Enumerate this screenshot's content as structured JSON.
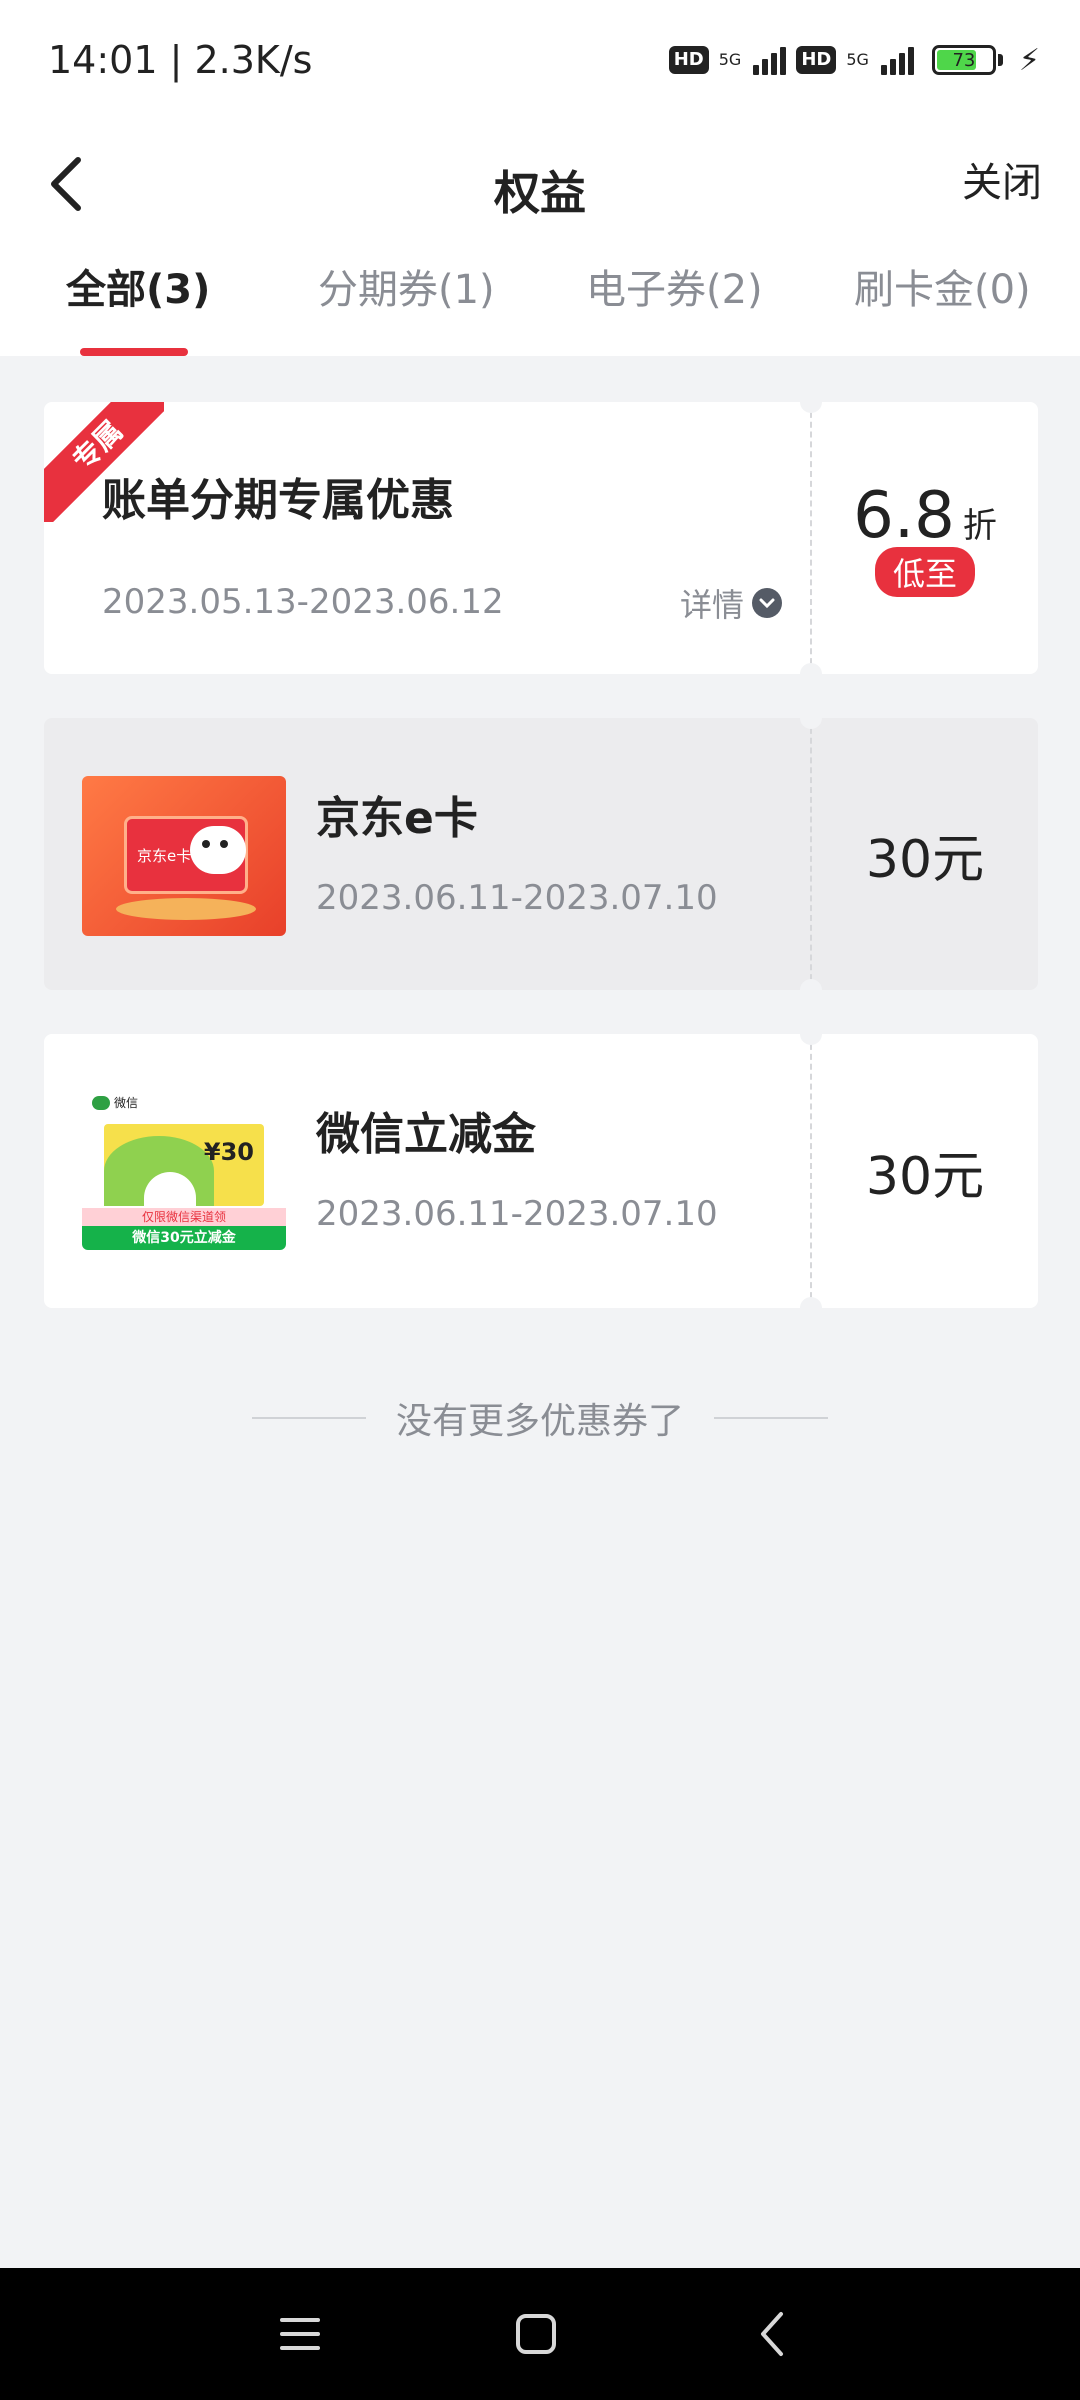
{
  "status": {
    "time_speed": "14:01 | 2.3K/s",
    "hd": "HD",
    "net": "5G",
    "battery": "73"
  },
  "nav": {
    "title": "权益",
    "close": "关闭"
  },
  "tabs": [
    {
      "label": "全部(3)"
    },
    {
      "label": "分期券(1)"
    },
    {
      "label": "电子券(2)"
    },
    {
      "label": "刷卡金(0)"
    }
  ],
  "coupons": [
    {
      "badge": "专属",
      "title": "账单分期专属优惠",
      "date": "2023.05.13-2023.06.12",
      "detail": "详情",
      "discount": "6.8",
      "discount_unit": "折",
      "min_label": "低至"
    },
    {
      "title": "京东e卡",
      "date": "2023.06.11-2023.07.10",
      "amount": "30元",
      "thumb_text": "京东e卡"
    },
    {
      "title": "微信立减金",
      "date": "2023.06.11-2023.07.10",
      "amount": "30元",
      "thumb_brand": "微信",
      "thumb_amount": "¥30",
      "thumb_note": "仅限微信渠道领",
      "thumb_banner": "微信30元立减金"
    }
  ],
  "footer": {
    "no_more": "没有更多优惠券了"
  },
  "colors": {
    "accent": "#e8313e",
    "background": "#f2f3f5"
  }
}
